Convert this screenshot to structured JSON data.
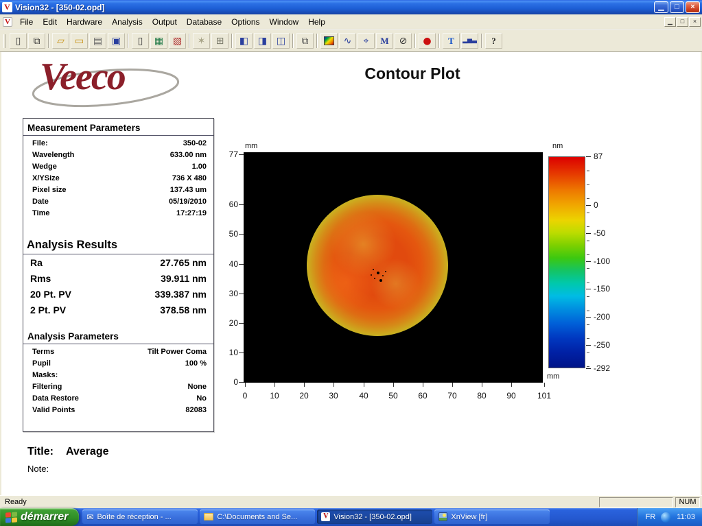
{
  "window": {
    "title": "Vision32 - [350-02.opd]",
    "icon_glyph": "V",
    "buttons": {
      "minimize": "▁",
      "restore": "□",
      "close": "×"
    },
    "menu": [
      "File",
      "Edit",
      "Hardware",
      "Analysis",
      "Output",
      "Database",
      "Options",
      "Window",
      "Help"
    ]
  },
  "toolbar": {
    "items": [
      {
        "name": "new-document",
        "glyph": "▯"
      },
      {
        "name": "open-document",
        "glyph": "⧉"
      },
      {
        "name": "open-folder",
        "glyph": "▱"
      },
      {
        "name": "save-dataset",
        "glyph": "▭"
      },
      {
        "name": "print",
        "glyph": "▤"
      },
      {
        "name": "save",
        "glyph": "▣"
      },
      {
        "name": "new-page",
        "glyph": "▯"
      },
      {
        "name": "page-table",
        "glyph": "▦"
      },
      {
        "name": "page-chart",
        "glyph": "▧"
      },
      {
        "name": "intensity",
        "glyph": "✶"
      },
      {
        "name": "tile-windows",
        "glyph": "⊞"
      },
      {
        "name": "view-contour",
        "glyph": "◧"
      },
      {
        "name": "view-profile",
        "glyph": "◨"
      },
      {
        "name": "view-data",
        "glyph": "◫"
      },
      {
        "name": "copy",
        "glyph": "⧉"
      },
      {
        "name": "color-map",
        "glyph": ""
      },
      {
        "name": "line-profile",
        "glyph": "∿"
      },
      {
        "name": "crosshair",
        "glyph": "⌖"
      },
      {
        "name": "measure",
        "glyph": "M"
      },
      {
        "name": "exclude",
        "glyph": "⊘"
      },
      {
        "name": "record-live",
        "glyph": "●"
      },
      {
        "name": "text-annotation",
        "glyph": "T"
      },
      {
        "name": "histogram",
        "glyph": "▂▅▃"
      },
      {
        "name": "help",
        "glyph": "?"
      }
    ]
  },
  "page": {
    "logo_text": "Veeco",
    "title": "Contour Plot",
    "measurement": {
      "heading": "Measurement Parameters",
      "rows": [
        {
          "label": "File:",
          "value": "350-02"
        },
        {
          "label": "Wavelength",
          "value": "633.00 nm"
        },
        {
          "label": "Wedge",
          "value": "1.00"
        },
        {
          "label": "X/YSize",
          "value": "736 X 480"
        },
        {
          "label": "Pixel size",
          "value": "137.43 um"
        },
        {
          "label": "Date",
          "value": "05/19/2010"
        },
        {
          "label": "Time",
          "value": "17:27:19"
        }
      ]
    },
    "results": {
      "heading": "Analysis Results",
      "rows": [
        {
          "label": "Ra",
          "value": "27.765 nm"
        },
        {
          "label": "Rms",
          "value": "39.911 nm"
        },
        {
          "label": "20 Pt. PV",
          "value": "339.387 nm"
        },
        {
          "label": "2 Pt. PV",
          "value": "378.58 nm"
        }
      ]
    },
    "parameters": {
      "heading": "Analysis Parameters",
      "rows": [
        {
          "label": "Terms",
          "value": "Tilt Power Coma"
        },
        {
          "label": "Pupil",
          "value": "100 %"
        },
        {
          "label": "Masks:",
          "value": ""
        },
        {
          "label": "Filtering",
          "value": "None"
        },
        {
          "label": "Data Restore",
          "value": "No"
        },
        {
          "label": "Valid Points",
          "value": "82083"
        }
      ]
    },
    "footer": {
      "title_label": "Title:",
      "title_value": "Average",
      "note_label": "Note:"
    }
  },
  "chart_data": {
    "type": "heatmap",
    "title": "Contour Plot",
    "x_unit": "mm",
    "y_unit": "mm",
    "z_unit": "nm",
    "x_ticks": [
      0,
      10,
      20,
      30,
      40,
      50,
      60,
      70,
      80,
      90,
      101
    ],
    "y_ticks": [
      0,
      10,
      20,
      30,
      40,
      50,
      60,
      77
    ],
    "x_range": [
      0,
      101
    ],
    "y_range": [
      0,
      77
    ],
    "colorbar": {
      "unit": "nm",
      "tick_labels": [
        87,
        0,
        -50,
        -100,
        -150,
        -200,
        -250,
        -292
      ],
      "range": [
        -292,
        87
      ]
    },
    "features": {
      "background": "black (no data)",
      "sample_shape": "circular disc",
      "disc_center_mm": [
        45,
        39
      ],
      "disc_radius_mm": 24,
      "disc_surface": "mostly orange-red (~+10 to +60 nm) with yellow mottling, yellow-green rim falling toward -100 nm, small black defect specks near center"
    }
  },
  "statusbar": {
    "message": "Ready",
    "num_indicator": "NUM"
  },
  "taskbar": {
    "start_label": "démarrer",
    "tasks": [
      {
        "label": "Boîte de réception - ...",
        "active": false
      },
      {
        "label": "C:\\Documents and Se...",
        "active": false
      },
      {
        "label": "Vision32 - [350-02.opd]",
        "active": true
      },
      {
        "label": "XnView [fr]",
        "active": false
      }
    ],
    "tray": {
      "language": "FR",
      "time": "11:03"
    }
  }
}
